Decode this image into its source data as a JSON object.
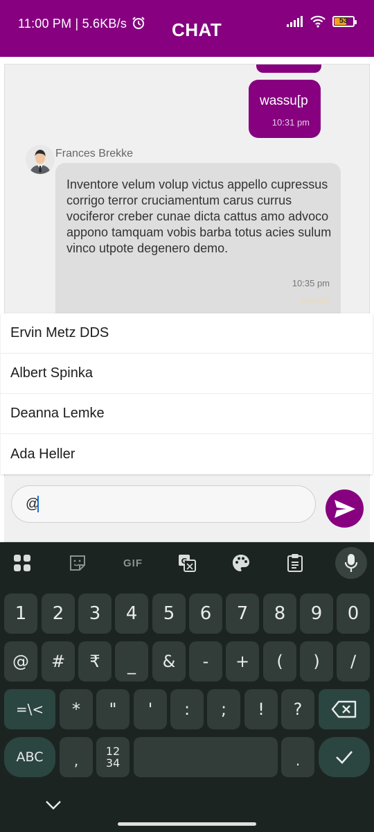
{
  "status_bar": {
    "time_speed": "11:00 PM | 5.6KB/s",
    "battery_level": "53"
  },
  "header": {
    "title": "CHAT"
  },
  "messages": {
    "outgoing": {
      "text": "wassu[p",
      "time": "10:31 pm"
    },
    "incoming": {
      "sender": "Frances Brekke",
      "text": "Inventore velum volup victus appello cupressus corrigo terror cruciamentum carus currus vociferor creber cunae dicta cattus amo advoco appono tamquam vobis barba totus acies sulum vinco utpote degenero demo.",
      "time": "10:35 pm",
      "edited": "(edited)"
    }
  },
  "mentions": [
    "Ervin Metz DDS",
    "Albert Spinka",
    "Deanna Lemke",
    "Ada Heller"
  ],
  "composer": {
    "value": "@"
  },
  "keyboard": {
    "toolbar": {
      "gif": "GIF"
    },
    "row1": [
      "1",
      "2",
      "3",
      "4",
      "5",
      "6",
      "7",
      "8",
      "9",
      "0"
    ],
    "row2": [
      "@",
      "#",
      "₹",
      "_",
      "&",
      "-",
      "+",
      "(",
      ")",
      "/"
    ],
    "row3": [
      "=\\<",
      "*",
      "\"",
      "'",
      ":",
      ";",
      "!",
      "?"
    ],
    "row4": {
      "abc": "ABC",
      "comma": ",",
      "numpad_top": "12",
      "numpad_bottom": "34",
      "period": "."
    }
  },
  "colors": {
    "brand": "#86007f",
    "keyboard_bg": "#1c2422",
    "key_bg": "#323c39"
  }
}
